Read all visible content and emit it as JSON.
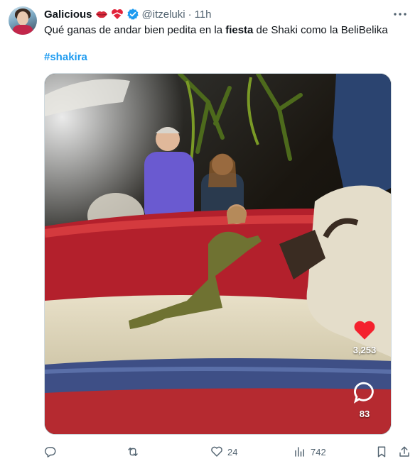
{
  "tweet": {
    "author_name": "Galicious",
    "handle": "@itzeluki",
    "separator": "·",
    "time": "11h",
    "verified": true,
    "badges": [
      "lips-emoji",
      "heart-ribbon-emoji"
    ],
    "text_before": "Qué ganas de andar bien pedita en la ",
    "text_bold": "fiesta",
    "text_after": " de Shaki como la BeliBelika",
    "hashtag": "#shakira"
  },
  "video_overlay": {
    "likes": "3,253",
    "comments": "83"
  },
  "actions": {
    "replies": "",
    "reposts": "",
    "likes": "24",
    "views": "742"
  },
  "colors": {
    "accent": "#1d9bf0",
    "secondary_text": "#536471",
    "like_red": "#f4212e"
  }
}
